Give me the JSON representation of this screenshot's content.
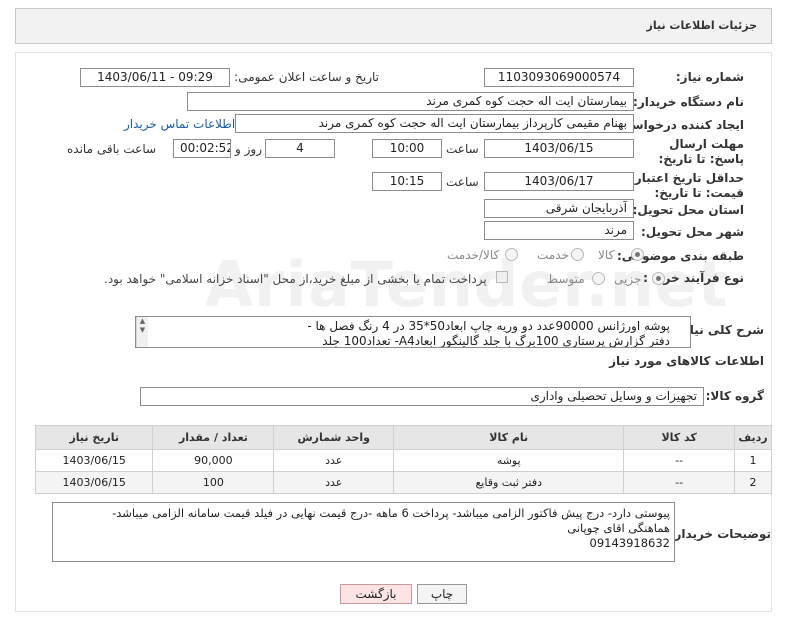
{
  "panel": {
    "title": "جزئیات اطلاعات نیاز"
  },
  "form": {
    "need_number_label": "شماره نیاز:",
    "need_number": "1103093069000574",
    "announce_label": "تاریخ و ساعت اعلان عمومی:",
    "announce_value": "1403/06/11 - 09:29",
    "buyer_org_label": "نام دستگاه خریدار:",
    "buyer_org": "بیمارستان ایت اله حجت کوه کمری مرند",
    "creator_label": "ایجاد کننده درخواست:",
    "creator": "بهنام مقیمی کارپرداز بیمارستان ایت اله حجت کوه کمری مرند",
    "contact_link": "اطلاعات تماس خریدار",
    "deadline_label": "مهلت ارسال پاسخ: تا تاریخ:",
    "deadline_date": "1403/06/15",
    "time_label": "ساعت",
    "deadline_time": "10:00",
    "days_value": "4",
    "days_label": "روز و",
    "remaining_value": "00:02:52",
    "remaining_label": "ساعت باقی مانده",
    "validity_label": "حداقل تاریخ اعتبار قیمت: تا تاریخ:",
    "validity_date": "1403/06/17",
    "validity_time_label": "ساعت",
    "validity_time": "10:15",
    "province_label": "استان محل تحویل:",
    "province": "آذربایجان شرقی",
    "city_label": "شهر محل تحویل:",
    "city": "مرند",
    "category_label": "طبقه بندی موضوعی:",
    "category_options": [
      "کالا",
      "خدمت",
      "کالا/خدمت"
    ],
    "category_selected": "کالا",
    "process_label": "نوع فرآیند خرید :",
    "process_options": [
      "جزیی",
      "متوسط"
    ],
    "process_selected": "جزیی",
    "payment_note": "پرداخت تمام یا بخشی از مبلغ خرید،از محل \"اسناد خزانه اسلامی\" خواهد بود.",
    "description_label": "شرح کلی نیاز:",
    "description_line1": "پوشه اورژانس 90000عدد دو وریه چاپ ابعاد50*35 در 4 رنگ فصل ها -",
    "description_line2": "دفتر گزارش پرستاری 100برگ با جلد گالینگور ابعادA4- تعداد100 جلد",
    "goods_info_title": "اطلاعات کالاهای مورد نیاز",
    "goods_group_label": "گروه کالا:",
    "goods_group": "تجهیزات و وسایل تحصیلی واداری"
  },
  "table": {
    "headers": [
      "ردیف",
      "کد کالا",
      "نام کالا",
      "واحد شمارش",
      "تعداد / مقدار",
      "تاریخ نیاز"
    ],
    "rows": [
      [
        "1",
        "--",
        "پوشه",
        "عدد",
        "90,000",
        "1403/06/15"
      ],
      [
        "2",
        "--",
        "دفتر ثبت وقایع",
        "عدد",
        "100",
        "1403/06/15"
      ]
    ]
  },
  "notes": {
    "label": "توضیحات خریدار:",
    "line1": "پیوستی دارد- درج پیش فاکتور الزامی میباشد-  پرداخت 6 ماهه -درج قیمت نهایی در فیلد قیمت سامانه الزامی میباشد-",
    "line2": "هماهنگی اقای چوپانی",
    "line3": "09143918632"
  },
  "buttons": {
    "print": "چاپ",
    "back": "بازگشت"
  },
  "watermark": "AriaTender.net"
}
